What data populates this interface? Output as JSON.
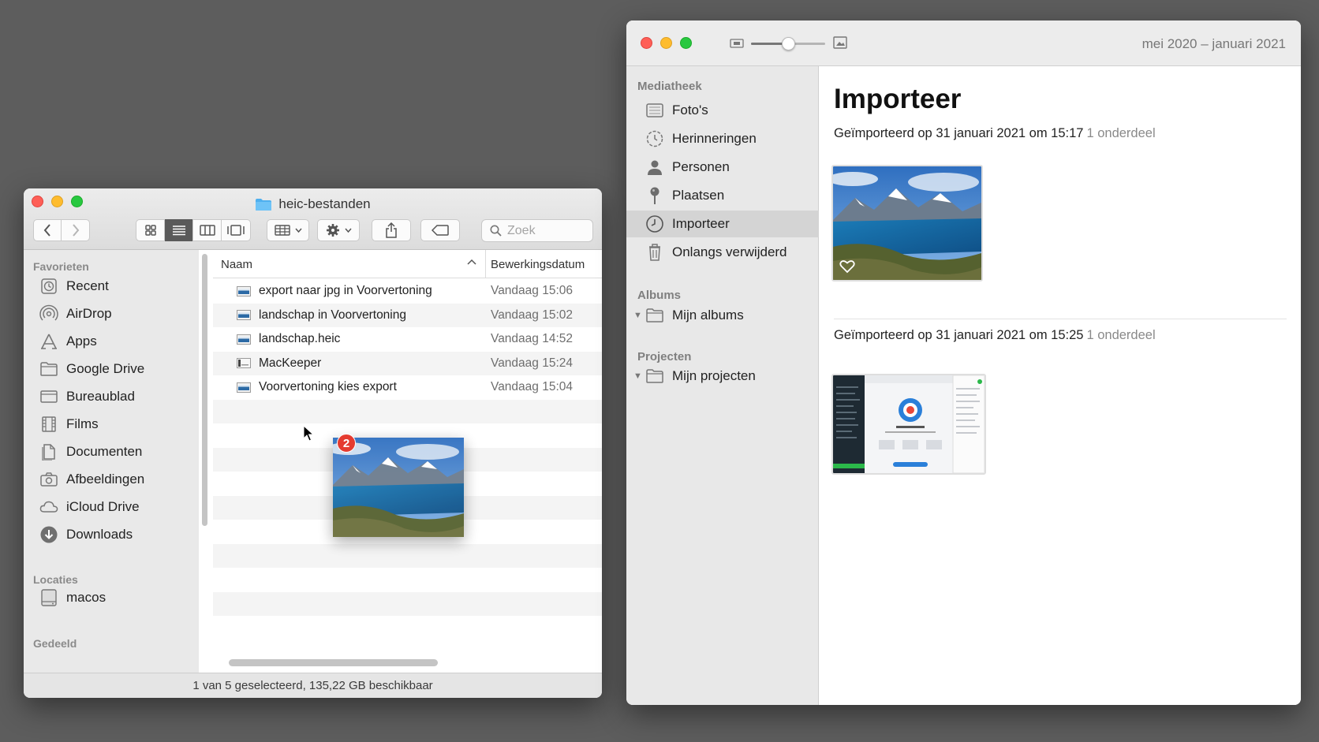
{
  "finder": {
    "title": "heic-bestanden",
    "search_placeholder": "Zoek",
    "sidebar": {
      "favorites_header": "Favorieten",
      "items": [
        {
          "label": "Recent",
          "icon": "clock-icon"
        },
        {
          "label": "AirDrop",
          "icon": "airdrop-icon"
        },
        {
          "label": "Apps",
          "icon": "apps-icon"
        },
        {
          "label": "Google Drive",
          "icon": "folder-icon"
        },
        {
          "label": "Bureaublad",
          "icon": "desktop-icon"
        },
        {
          "label": "Films",
          "icon": "film-icon"
        },
        {
          "label": "Documenten",
          "icon": "document-icon"
        },
        {
          "label": "Afbeeldingen",
          "icon": "camera-icon"
        },
        {
          "label": "iCloud Drive",
          "icon": "cloud-icon"
        },
        {
          "label": "Downloads",
          "icon": "download-icon"
        }
      ],
      "locations_header": "Locaties",
      "locations": [
        {
          "label": "macos",
          "icon": "disk-icon"
        }
      ],
      "shared_header": "Gedeeld"
    },
    "columns": {
      "name": "Naam",
      "date": "Bewerkingsdatum"
    },
    "files": [
      {
        "name": "export naar jpg in Voorvertoning",
        "date": "Vandaag 15:06"
      },
      {
        "name": "landschap in Voorvertoning",
        "date": "Vandaag 15:02"
      },
      {
        "name": "landschap.heic",
        "date": "Vandaag 14:52"
      },
      {
        "name": "MacKeeper",
        "date": "Vandaag 15:24"
      },
      {
        "name": "Voorvertoning kies export",
        "date": "Vandaag 15:04"
      }
    ],
    "status": "1 van 5 geselecteerd, 135,22 GB beschikbaar",
    "drag_badge": "2"
  },
  "photos": {
    "date_range": "mei 2020 – januari 2021",
    "zoom_level": 0.5,
    "sidebar": {
      "library_header": "Mediatheek",
      "library": [
        {
          "label": "Foto's",
          "icon": "photos-icon"
        },
        {
          "label": "Herinneringen",
          "icon": "memories-icon"
        },
        {
          "label": "Personen",
          "icon": "person-icon"
        },
        {
          "label": "Plaatsen",
          "icon": "pin-icon"
        },
        {
          "label": "Importeer",
          "icon": "clock-icon"
        },
        {
          "label": "Onlangs verwijderd",
          "icon": "trash-icon"
        }
      ],
      "albums_header": "Albums",
      "albums_item": "Mijn albums",
      "projects_header": "Projecten",
      "projects_item": "Mijn projecten"
    },
    "heading": "Importeer",
    "imports": [
      {
        "label": "Geïmporteerd op 31 januari 2021 om 15:17",
        "count": "1 onderdeel"
      },
      {
        "label": "Geïmporteerd op 31 januari 2021 om 15:25",
        "count": "1 onderdeel"
      }
    ],
    "colors": {
      "close": "#fe5f57",
      "minimize": "#febc2e",
      "maximize": "#28c840",
      "selection": "#d4d4d4"
    }
  }
}
